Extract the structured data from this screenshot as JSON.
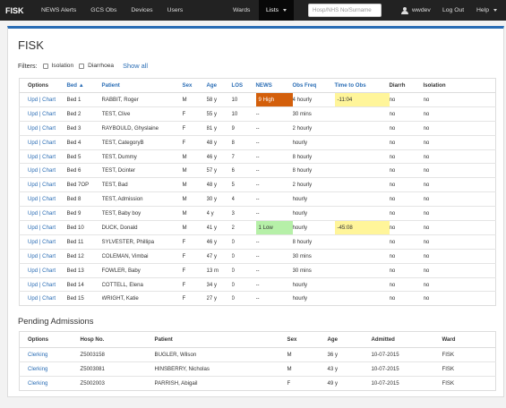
{
  "nav": {
    "brand": "FISK",
    "left_items": [
      "NEWS Alerts",
      "GCS Obs",
      "Devices",
      "Users"
    ],
    "wards_label": "Wards",
    "lists_label": "Lists",
    "search_placeholder": "Hosp/NHS No/Surname",
    "username": "wwdev",
    "logout_label": "Log Out",
    "help_label": "Help"
  },
  "page": {
    "title": "FISK",
    "filters_label": "Filters:",
    "filter_isolation": "Isolation",
    "filter_diarrhoea": "Diarrhoea",
    "show_all": "Show all"
  },
  "colors": {
    "accent": "#2a6db5",
    "news_high": "#d35f0b",
    "news_low": "#b6f0a8",
    "time_warn": "#fff59a"
  },
  "patients": {
    "headers": [
      "Options",
      "Bed ▲",
      "Patient",
      "Sex",
      "Age",
      "LOS",
      "NEWS",
      "Obs Freq",
      "Time to Obs",
      "Diarrh",
      "Isolation"
    ],
    "rows": [
      {
        "upd": "Upd",
        "chart": "Chart",
        "bed": "Bed 1",
        "patient": "RABBIT, Roger",
        "sex": "M",
        "age": "58 y",
        "los": "10",
        "news": "9 High",
        "news_level": "high",
        "obs_freq": "4 hourly",
        "time_to_obs": "-11:04",
        "tto_warn": true,
        "diarrh": "no",
        "isolation": "no"
      },
      {
        "upd": "Upd",
        "chart": "Chart",
        "bed": "Bed 2",
        "patient": "TEST, Clive",
        "sex": "F",
        "age": "55 y",
        "los": "10",
        "news": "--",
        "news_level": "",
        "obs_freq": "30 mins",
        "time_to_obs": "",
        "tto_warn": false,
        "diarrh": "no",
        "isolation": "no"
      },
      {
        "upd": "Upd",
        "chart": "Chart",
        "bed": "Bed 3",
        "patient": "RAYBOULD, Ghyslaine",
        "sex": "F",
        "age": "81 y",
        "los": "9",
        "news": "--",
        "news_level": "",
        "obs_freq": "2 hourly",
        "time_to_obs": "",
        "tto_warn": false,
        "diarrh": "no",
        "isolation": "no"
      },
      {
        "upd": "Upd",
        "chart": "Chart",
        "bed": "Bed 4",
        "patient": "TEST, CategoryB",
        "sex": "F",
        "age": "48 y",
        "los": "8",
        "news": "--",
        "news_level": "",
        "obs_freq": "hourly",
        "time_to_obs": "",
        "tto_warn": false,
        "diarrh": "no",
        "isolation": "no"
      },
      {
        "upd": "Upd",
        "chart": "Chart",
        "bed": "Bed 5",
        "patient": "TEST, Dummy",
        "sex": "M",
        "age": "46 y",
        "los": "7",
        "news": "--",
        "news_level": "",
        "obs_freq": "8 hourly",
        "time_to_obs": "",
        "tto_warn": false,
        "diarrh": "no",
        "isolation": "no"
      },
      {
        "upd": "Upd",
        "chart": "Chart",
        "bed": "Bed 6",
        "patient": "TEST, Dcinter",
        "sex": "M",
        "age": "57 y",
        "los": "6",
        "news": "--",
        "news_level": "",
        "obs_freq": "8 hourly",
        "time_to_obs": "",
        "tto_warn": false,
        "diarrh": "no",
        "isolation": "no"
      },
      {
        "upd": "Upd",
        "chart": "Chart",
        "bed": "Bed 7OP",
        "patient": "TEST, Bad",
        "sex": "M",
        "age": "48 y",
        "los": "5",
        "news": "--",
        "news_level": "",
        "obs_freq": "2 hourly",
        "time_to_obs": "",
        "tto_warn": false,
        "diarrh": "no",
        "isolation": "no"
      },
      {
        "upd": "Upd",
        "chart": "Chart",
        "bed": "Bed 8",
        "patient": "TEST, Admission",
        "sex": "M",
        "age": "30 y",
        "los": "4",
        "news": "--",
        "news_level": "",
        "obs_freq": "hourly",
        "time_to_obs": "",
        "tto_warn": false,
        "diarrh": "no",
        "isolation": "no"
      },
      {
        "upd": "Upd",
        "chart": "Chart",
        "bed": "Bed 9",
        "patient": "TEST, Baby boy",
        "sex": "M",
        "age": "4 y",
        "los": "3",
        "news": "--",
        "news_level": "",
        "obs_freq": "hourly",
        "time_to_obs": "",
        "tto_warn": false,
        "diarrh": "no",
        "isolation": "no"
      },
      {
        "upd": "Upd",
        "chart": "Chart",
        "bed": "Bed 10",
        "patient": "DUCK, Donald",
        "sex": "M",
        "age": "41 y",
        "los": "2",
        "news": "1 Low",
        "news_level": "low",
        "obs_freq": "hourly",
        "time_to_obs": "-45:08",
        "tto_warn": true,
        "diarrh": "no",
        "isolation": "no"
      },
      {
        "upd": "Upd",
        "chart": "Chart",
        "bed": "Bed 11",
        "patient": "SYLVESTER, Phillipa",
        "sex": "F",
        "age": "46 y",
        "los": "0",
        "news": "--",
        "news_level": "",
        "obs_freq": "8 hourly",
        "time_to_obs": "",
        "tto_warn": false,
        "diarrh": "no",
        "isolation": "no"
      },
      {
        "upd": "Upd",
        "chart": "Chart",
        "bed": "Bed 12",
        "patient": "COLEMAN, Vimbai",
        "sex": "F",
        "age": "47 y",
        "los": "0",
        "news": "--",
        "news_level": "",
        "obs_freq": "30 mins",
        "time_to_obs": "",
        "tto_warn": false,
        "diarrh": "no",
        "isolation": "no"
      },
      {
        "upd": "Upd",
        "chart": "Chart",
        "bed": "Bed 13",
        "patient": "FOWLER, Baby",
        "sex": "F",
        "age": "13 m",
        "los": "0",
        "news": "--",
        "news_level": "",
        "obs_freq": "30 mins",
        "time_to_obs": "",
        "tto_warn": false,
        "diarrh": "no",
        "isolation": "no"
      },
      {
        "upd": "Upd",
        "chart": "Chart",
        "bed": "Bed 14",
        "patient": "COTTELL, Elena",
        "sex": "F",
        "age": "34 y",
        "los": "0",
        "news": "--",
        "news_level": "",
        "obs_freq": "hourly",
        "time_to_obs": "",
        "tto_warn": false,
        "diarrh": "no",
        "isolation": "no"
      },
      {
        "upd": "Upd",
        "chart": "Chart",
        "bed": "Bed 15",
        "patient": "WRIGHT, Katie",
        "sex": "F",
        "age": "27 y",
        "los": "0",
        "news": "--",
        "news_level": "",
        "obs_freq": "hourly",
        "time_to_obs": "",
        "tto_warn": false,
        "diarrh": "no",
        "isolation": "no"
      }
    ]
  },
  "pending": {
    "title": "Pending Admissions",
    "headers": [
      "Options",
      "Hosp No.",
      "Patient",
      "Sex",
      "Age",
      "Admitted",
      "Ward"
    ],
    "rows": [
      {
        "option": "Clerking",
        "hosp_no": "Z5003158",
        "patient": "BUGLER, Wilson",
        "sex": "M",
        "age": "36 y",
        "admitted": "10-07-2015",
        "ward": "FISK"
      },
      {
        "option": "Clerking",
        "hosp_no": "Z5003081",
        "patient": "HINSBERRY, Nicholas",
        "sex": "M",
        "age": "43 y",
        "admitted": "10-07-2015",
        "ward": "FISK"
      },
      {
        "option": "Clerking",
        "hosp_no": "Z5002003",
        "patient": "PARRISH, Abigail",
        "sex": "F",
        "age": "49 y",
        "admitted": "10-07-2015",
        "ward": "FISK"
      }
    ]
  }
}
